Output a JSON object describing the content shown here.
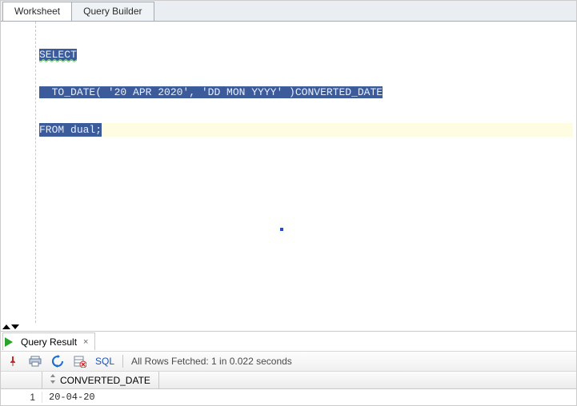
{
  "tabs": {
    "worksheet": "Worksheet",
    "query_builder": "Query Builder"
  },
  "editor": {
    "line1": "SELECT",
    "line2_kw": "TO_DATE",
    "line2_rest": "( '20 APR 2020', 'DD MON YYYY' )CONVERTED_DATE",
    "line3_kw": "FROM",
    "line3_rest": " dual;"
  },
  "result_tab": {
    "label": "Query Result",
    "close": "×"
  },
  "toolbar": {
    "sql_label": "SQL",
    "status": "All Rows Fetched: 1 in 0.022 seconds"
  },
  "grid": {
    "col1": "CONVERTED_DATE",
    "row1_num": "1",
    "row1_val": "20-04-20"
  }
}
